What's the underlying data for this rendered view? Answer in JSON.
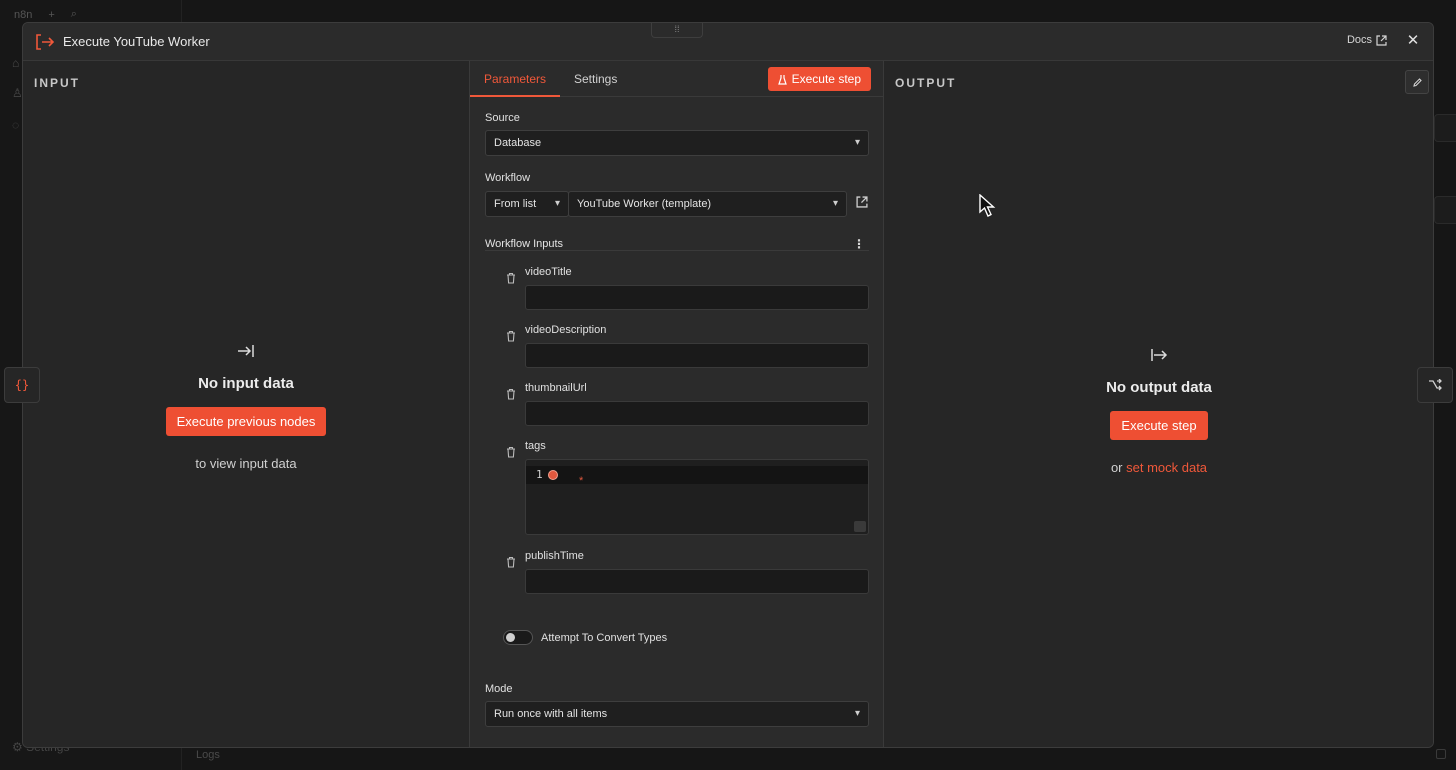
{
  "background": {
    "app_name": "n8n",
    "settings_label": "Settings",
    "logs_label": "Logs"
  },
  "modal": {
    "title": "Execute YouTube Worker",
    "docs_label": "Docs",
    "close_glyph": "✕",
    "drag_glyph": "⁞⁞"
  },
  "input_panel": {
    "label": "INPUT",
    "empty_title": "No input data",
    "button": "Execute previous nodes",
    "hint": "to view input data"
  },
  "params": {
    "tabs": [
      "Parameters",
      "Settings"
    ],
    "active_tab": "Parameters",
    "execute_step": "Execute step",
    "source": {
      "label": "Source",
      "value": "Database"
    },
    "workflow": {
      "label": "Workflow",
      "mode": "From list",
      "value": "YouTube Worker (template)"
    },
    "workflow_inputs_label": "Workflow Inputs",
    "inputs": [
      {
        "name": "videoTitle",
        "value": ""
      },
      {
        "name": "videoDescription",
        "value": ""
      },
      {
        "name": "thumbnailUrl",
        "value": ""
      },
      {
        "name": "tags",
        "value": "",
        "line_number": "1"
      },
      {
        "name": "publishTime",
        "value": ""
      }
    ],
    "convert_types": {
      "label": "Attempt To Convert Types",
      "enabled": false
    },
    "mode": {
      "label": "Mode",
      "value": "Run once with all items"
    }
  },
  "output_panel": {
    "label": "OUTPUT",
    "empty_title": "No output data",
    "button": "Execute step",
    "hint_prefix": "or ",
    "hint_link": "set mock data"
  },
  "side_tabs": {
    "left_glyph": "{}"
  },
  "colors": {
    "accent": "#ee4f33",
    "panel_bg": "#262626",
    "params_bg": "#2b2b2b",
    "input_bg": "#1a1a1a"
  }
}
